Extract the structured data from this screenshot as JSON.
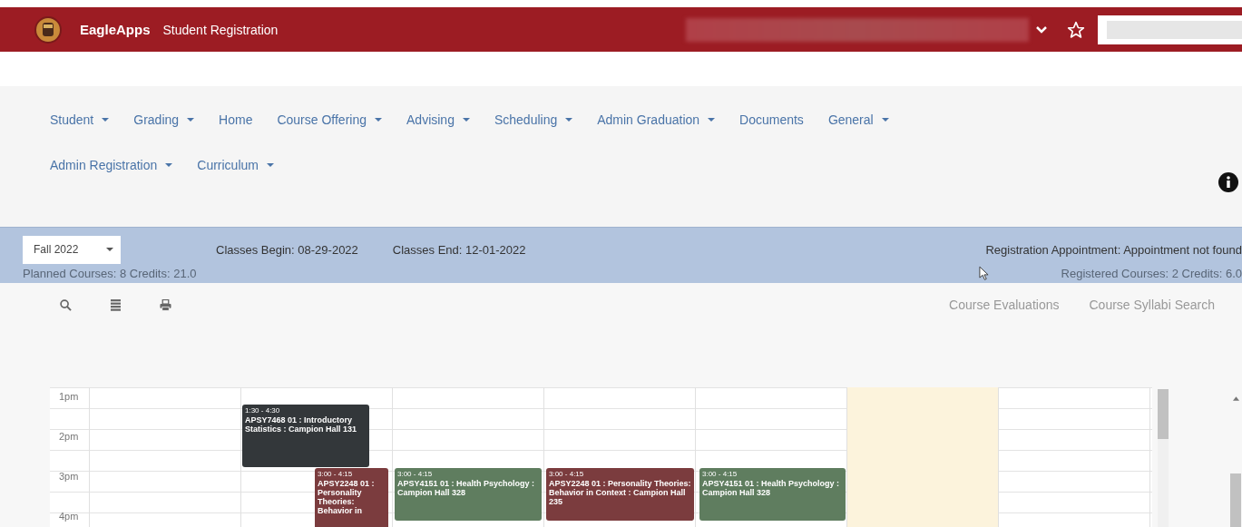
{
  "header": {
    "brand": "EagleApps",
    "app_title": "Student Registration"
  },
  "nav": {
    "items": [
      {
        "label": "Student",
        "dropdown": true
      },
      {
        "label": "Grading",
        "dropdown": true
      },
      {
        "label": "Home",
        "dropdown": false
      },
      {
        "label": "Course Offering",
        "dropdown": true
      },
      {
        "label": "Advising",
        "dropdown": true
      },
      {
        "label": "Scheduling",
        "dropdown": true
      },
      {
        "label": "Admin Graduation",
        "dropdown": true
      },
      {
        "label": "Documents",
        "dropdown": false
      },
      {
        "label": "General",
        "dropdown": true
      },
      {
        "label": "Admin Registration",
        "dropdown": true
      },
      {
        "label": "Curriculum",
        "dropdown": true
      }
    ]
  },
  "term_bar": {
    "term_select": "Fall 2022",
    "classes_begin": "Classes Begin:  08-29-2022",
    "classes_end": "Classes End:  12-01-2022",
    "appointment": "Registration Appointment:  Appointment not found",
    "planned": "Planned Courses:  8  Credits:  21.0",
    "registered": "Registered Courses:  2  Credits:  6.0"
  },
  "toolbar": {
    "links": [
      "Course Evaluations",
      "Course Syllabi Search"
    ]
  },
  "calendar": {
    "hours": [
      "1pm",
      "2pm",
      "3pm",
      "4pm"
    ],
    "columns": [
      {
        "today": false
      },
      {
        "today": false
      },
      {
        "today": false
      },
      {
        "today": false
      },
      {
        "today": false
      },
      {
        "today": true
      },
      {
        "today": false
      }
    ],
    "events": [
      {
        "time": "1:30 - 4:30",
        "title": "APSY7468 01 : Introductory Statistics : Campion Hall 131",
        "color": "#33373a"
      },
      {
        "time": "3:00 - 4:15",
        "title": "APSY2248 01 : Personality Theories: Behavior in",
        "color": "#7b3c3e"
      },
      {
        "time": "3:00 - 4:15",
        "title": "APSY4151 01 : Health Psychology : Campion Hall 328",
        "color": "#5f7d5f"
      },
      {
        "time": "3:00 - 4:15",
        "title": "APSY2248 01 : Personality Theories: Behavior in Context : Campion Hall 235",
        "color": "#7b3c3e"
      },
      {
        "time": "3:00 - 4:15",
        "title": "APSY4151 01 : Health Psychology : Campion Hall 328",
        "color": "#5f7d5f"
      }
    ]
  }
}
